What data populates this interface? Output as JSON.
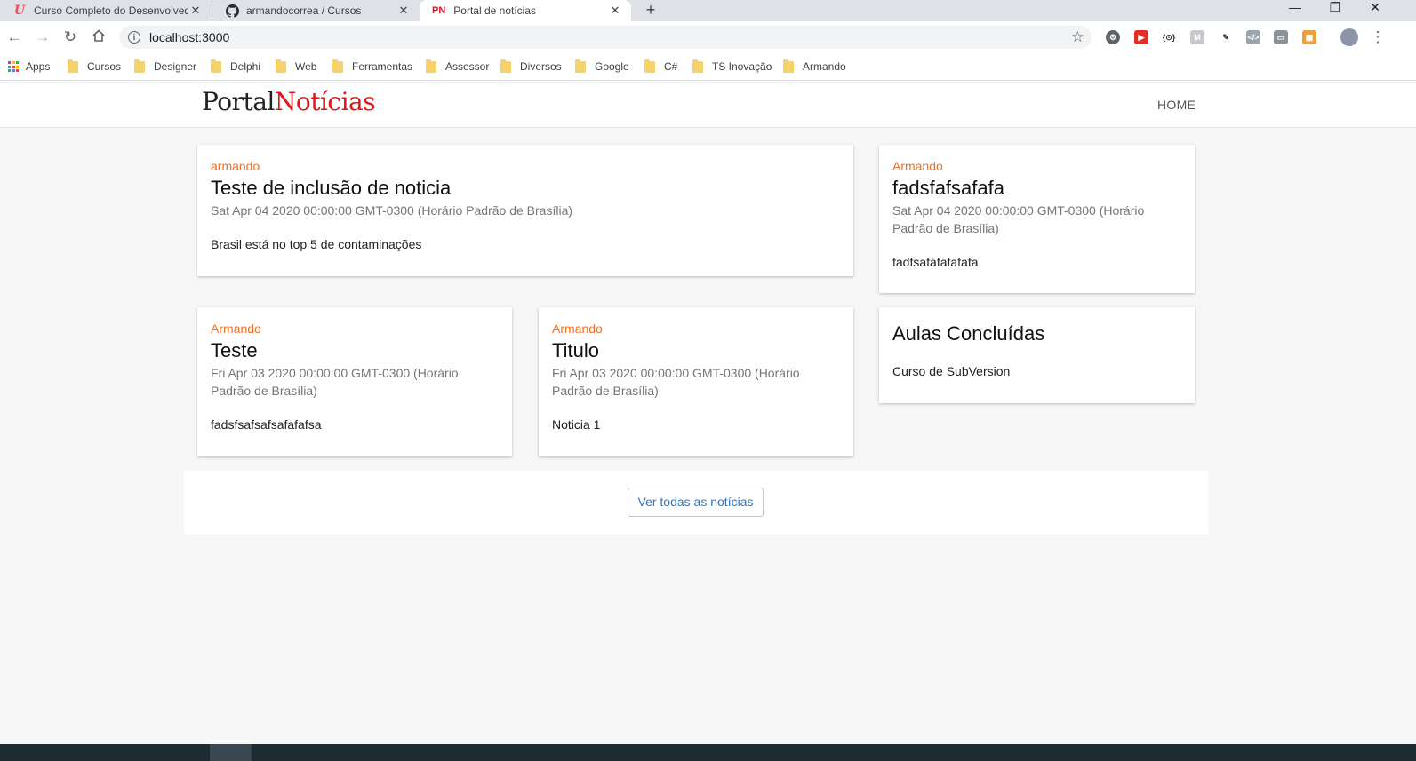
{
  "browser": {
    "tabs": [
      {
        "favicon": "U",
        "favicon_color": "#ec5252",
        "title": "Curso Completo do Desenvolvedor",
        "active": false
      },
      {
        "favicon": "github-icon",
        "title": "armandocorrea / Cursos",
        "active": false
      },
      {
        "favicon": "PN",
        "favicon_color": "#e0161d",
        "title": "Portal de notícias",
        "active": true
      }
    ],
    "new_tab_symbol": "+",
    "window_controls": {
      "minimize": "—",
      "restore": "❐",
      "close": "✕"
    },
    "url": "localhost:3000",
    "bookmarks": [
      "Apps",
      "Cursos",
      "Designer",
      "Delphi",
      "Web",
      "Ferramentas",
      "Assessor",
      "Diversos",
      "Google",
      "C#",
      "TS Inovação",
      "Armando"
    ]
  },
  "site": {
    "logo_part1": "Portal",
    "logo_part2": "Notícias",
    "nav_home": "HOME"
  },
  "news": [
    {
      "author": "armando",
      "title": "Teste de inclusão de noticia",
      "date": "Sat Apr 04 2020 00:00:00 GMT-0300 (Horário Padrão de Brasília)",
      "body": "Brasil está no top 5 de contaminações"
    },
    {
      "author": "Armando",
      "title": "fadsfafsafafa",
      "date": "Sat Apr 04 2020 00:00:00 GMT-0300 (Horário Padrão de Brasília)",
      "body": "fadfsafafafafafa"
    },
    {
      "author": "Armando",
      "title": "Teste",
      "date": "Fri Apr 03 2020 00:00:00 GMT-0300 (Horário Padrão de Brasília)",
      "body": "fadsfsafsafsafafafsa"
    },
    {
      "author": "Armando",
      "title": "Titulo",
      "date": "Fri Apr 03 2020 00:00:00 GMT-0300 (Horário Padrão de Brasília)",
      "body": "Noticia 1"
    }
  ],
  "completed": {
    "title": "Aulas Concluídas",
    "items": [
      "Curso de SubVersion"
    ]
  },
  "see_all_label": "Ver todas as notícias",
  "colors": {
    "author": "#ee6e21",
    "logo_accent": "#e0161d",
    "link": "#2f74c0",
    "page_bg": "#f7f7f7"
  }
}
